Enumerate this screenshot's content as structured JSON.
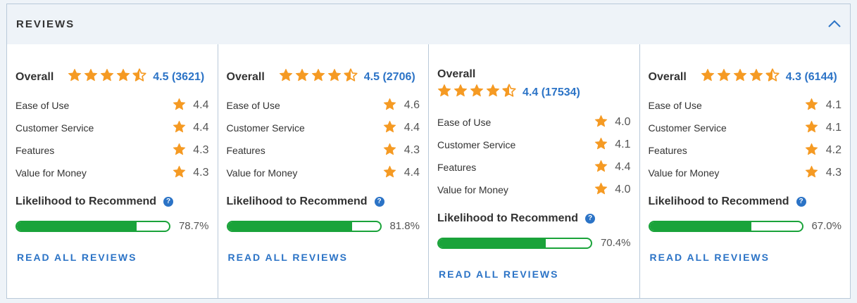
{
  "section": {
    "title": "REVIEWS"
  },
  "colors": {
    "star": "#f59a23",
    "link": "#2b73c6",
    "bar": "#1aa33a"
  },
  "labels": {
    "overall": "Overall",
    "likelihood": "Likelihood to Recommend",
    "read_all": "READ ALL REVIEWS",
    "help_icon": "?"
  },
  "products": [
    {
      "overall_score": "4.5 (3621)",
      "stars": 4.5,
      "subs": [
        {
          "label": "Ease of Use",
          "value": "4.4"
        },
        {
          "label": "Customer Service",
          "value": "4.4"
        },
        {
          "label": "Features",
          "value": "4.3"
        },
        {
          "label": "Value for Money",
          "value": "4.3"
        }
      ],
      "recommend_pct": "78.7%",
      "recommend_value": 78.7
    },
    {
      "overall_score": "4.5 (2706)",
      "stars": 4.5,
      "subs": [
        {
          "label": "Ease of Use",
          "value": "4.6"
        },
        {
          "label": "Customer Service",
          "value": "4.4"
        },
        {
          "label": "Features",
          "value": "4.3"
        },
        {
          "label": "Value for Money",
          "value": "4.4"
        }
      ],
      "recommend_pct": "81.8%",
      "recommend_value": 81.8
    },
    {
      "overall_score": "4.4 (17534)",
      "stars": 4.5,
      "subs": [
        {
          "label": "Ease of Use",
          "value": "4.0"
        },
        {
          "label": "Customer Service",
          "value": "4.1"
        },
        {
          "label": "Features",
          "value": "4.4"
        },
        {
          "label": "Value for Money",
          "value": "4.0"
        }
      ],
      "recommend_pct": "70.4%",
      "recommend_value": 70.4
    },
    {
      "overall_score": "4.3 (6144)",
      "stars": 4.5,
      "subs": [
        {
          "label": "Ease of Use",
          "value": "4.1"
        },
        {
          "label": "Customer Service",
          "value": "4.1"
        },
        {
          "label": "Features",
          "value": "4.2"
        },
        {
          "label": "Value for Money",
          "value": "4.3"
        }
      ],
      "recommend_pct": "67.0%",
      "recommend_value": 67.0
    }
  ]
}
